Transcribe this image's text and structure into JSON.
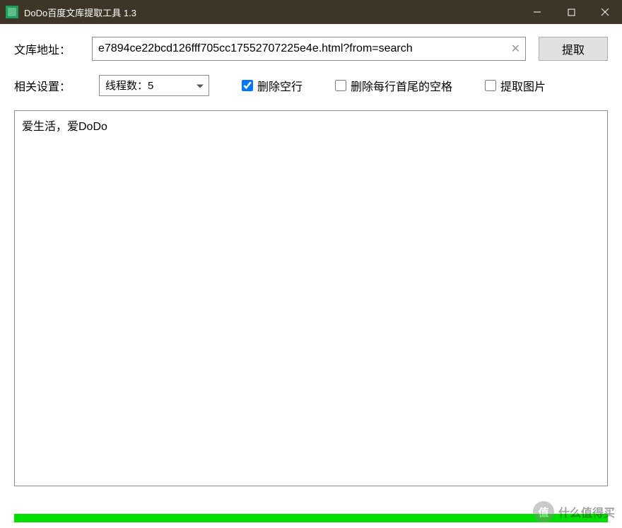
{
  "window": {
    "title": "DoDo百度文库提取工具  1.3"
  },
  "form": {
    "url_label": "文库地址：",
    "url_value": "e7894ce22bcd126fff705cc17552707225e4e.html?from=search",
    "extract_button": "提取",
    "settings_label": "相关设置：",
    "thread_option": "线程数：5",
    "checkbox_delete_blank": "删除空行",
    "checkbox_delete_blank_checked": true,
    "checkbox_trim_spaces": "删除每行首尾的空格",
    "checkbox_trim_spaces_checked": false,
    "checkbox_extract_images": "提取图片",
    "checkbox_extract_images_checked": false
  },
  "output": {
    "text": "爱生活，爱DoDo"
  },
  "watermark": {
    "badge": "值",
    "text": "什么值得买"
  }
}
